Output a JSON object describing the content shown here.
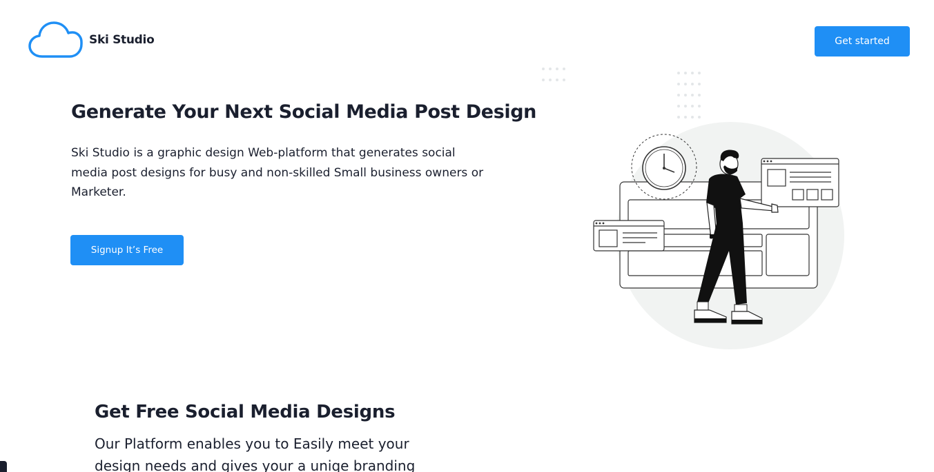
{
  "header": {
    "brand_name": "Ski Studio",
    "cta_label": "Get started"
  },
  "hero": {
    "title": "Generate Your Next Social Media Post Design",
    "description": "Ski Studio is a graphic design Web-platform that generates social media post designs for busy and non-skilled Small business owners or Marketer.",
    "signup_label": "Signup It’s Free"
  },
  "features": {
    "title": "Get Free Social Media Designs",
    "description": "Our Platform enables you to Easily meet your design needs and gives your a uniqe branding"
  },
  "colors": {
    "accent": "#1f8ff5",
    "text": "#1a1f2e",
    "illustration_bg": "#f1f3f2"
  },
  "icons": {
    "logo": "cloud-icon"
  }
}
